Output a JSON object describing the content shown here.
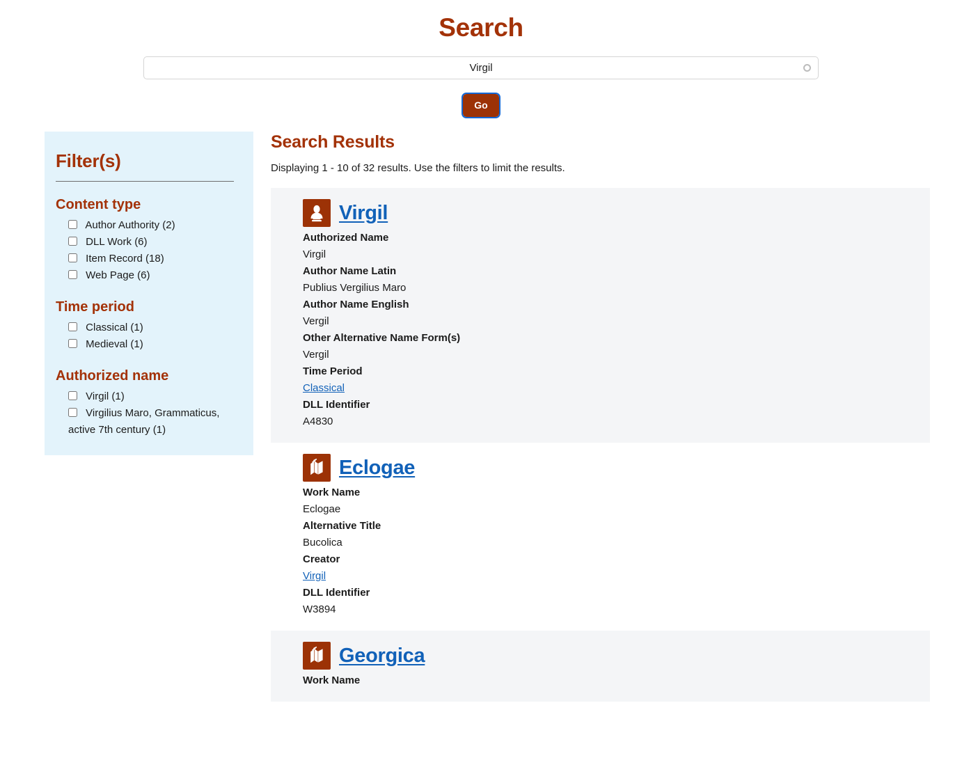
{
  "header": {
    "title": "Search"
  },
  "search": {
    "value": "Virgil",
    "placeholder": "Search",
    "go_label": "Go",
    "spinner_icon": "loading-circle-icon"
  },
  "facets": {
    "title": "Filter(s)",
    "groups": [
      {
        "title": "Content type",
        "items": [
          {
            "label": "Author Authority (2)"
          },
          {
            "label": "DLL Work (6)"
          },
          {
            "label": "Item Record (18)"
          },
          {
            "label": "Web Page (6)"
          }
        ]
      },
      {
        "title": "Time period",
        "items": [
          {
            "label": "Classical (1)"
          },
          {
            "label": "Medieval (1)"
          }
        ]
      },
      {
        "title": "Authorized name",
        "items": [
          {
            "label": "Virgil (1)"
          },
          {
            "label": "Virgilius Maro, Grammaticus, active 7th century (1)"
          }
        ]
      }
    ]
  },
  "results": {
    "title": "Search Results",
    "summary": "Displaying 1 - 10 of 32 results. Use the filters to limit the results.",
    "items": [
      {
        "title": "Virgil",
        "icon": "author-bust-icon",
        "shaded": true,
        "fields": [
          {
            "label": "Authorized Name",
            "value": "Virgil",
            "link": false
          },
          {
            "label": "Author Name Latin",
            "value": "Publius Vergilius Maro",
            "link": false
          },
          {
            "label": "Author Name English",
            "value": "Vergil",
            "link": false
          },
          {
            "label": "Other Alternative Name Form(s)",
            "value": "Vergil",
            "link": false
          },
          {
            "label": "Time Period",
            "value": "Classical",
            "link": true
          },
          {
            "label": "DLL Identifier",
            "value": "A4830",
            "link": false
          }
        ]
      },
      {
        "title": "Eclogae",
        "icon": "books-icon",
        "shaded": false,
        "fields": [
          {
            "label": "Work Name",
            "value": "Eclogae",
            "link": false
          },
          {
            "label": "Alternative Title",
            "value": "Bucolica",
            "link": false
          },
          {
            "label": "Creator",
            "value": "Virgil",
            "link": true
          },
          {
            "label": "DLL Identifier",
            "value": "W3894",
            "link": false
          }
        ]
      },
      {
        "title": "Georgica",
        "icon": "books-icon",
        "shaded": true,
        "fields": [
          {
            "label": "Work Name",
            "value": "",
            "link": false
          }
        ]
      }
    ]
  },
  "colors": {
    "accent": "#a33208",
    "button": "#9c3206",
    "link": "#1161b8",
    "facet_bg": "#e3f3fb",
    "card_shaded": "#f4f5f7",
    "focus_ring": "#1368d6"
  }
}
